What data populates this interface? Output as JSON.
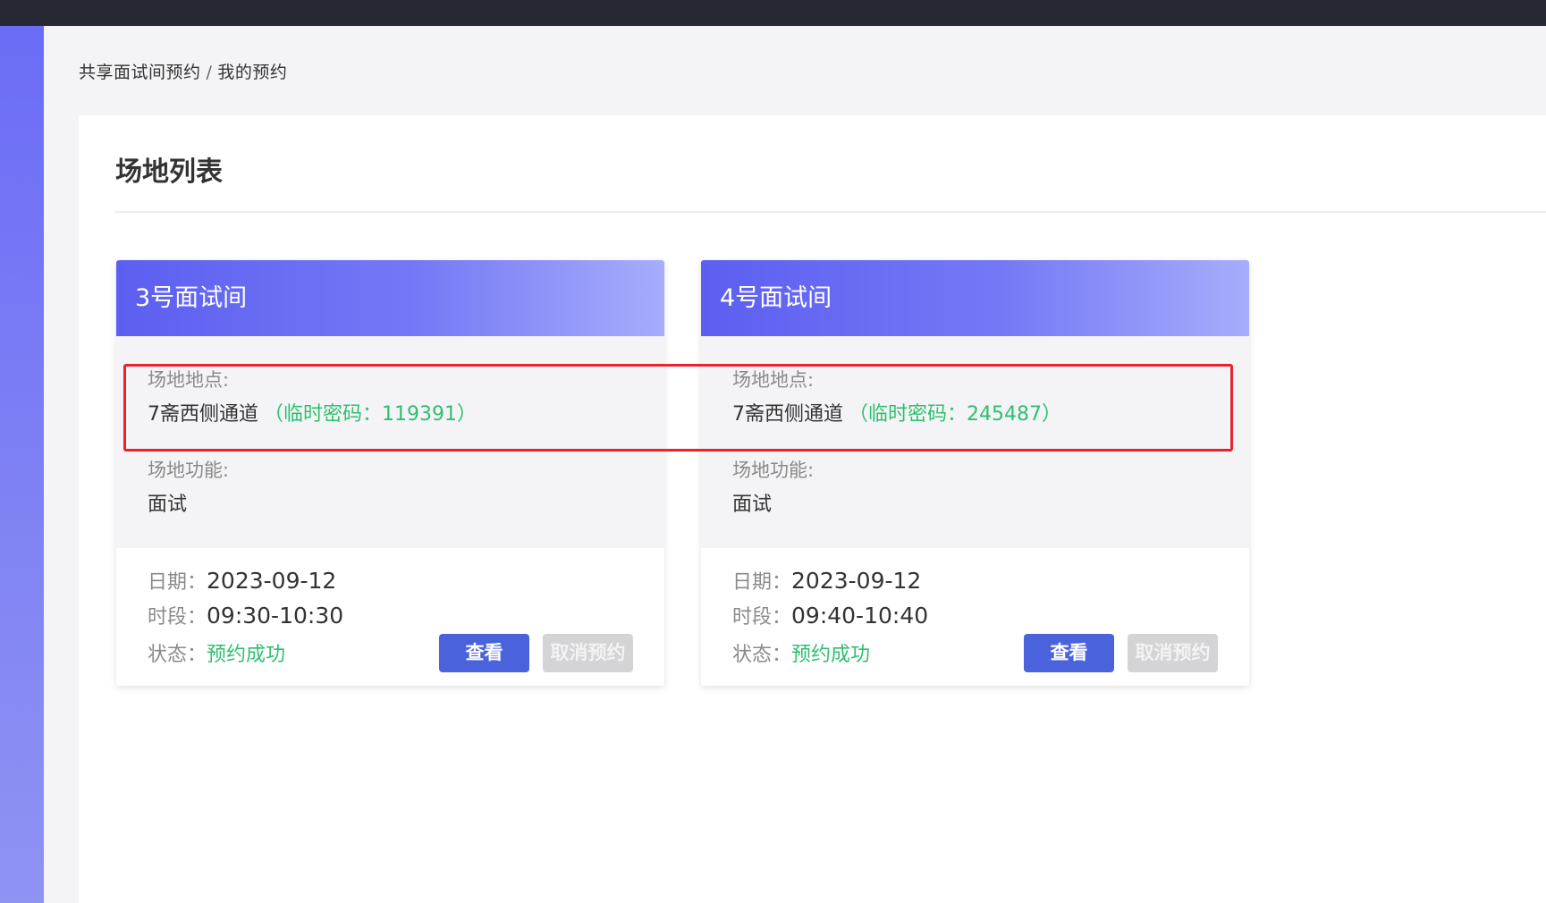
{
  "breadcrumb": {
    "root": "共享面试间预约",
    "separator": "/",
    "current": "我的预约"
  },
  "panel": {
    "title": "场地列表"
  },
  "cards": [
    {
      "name": "3号面试间",
      "location_label": "场地地点:",
      "location": "7斋西侧通道",
      "temp_password": "（临时密码：119391）",
      "function_label": "场地功能:",
      "function": "面试",
      "date_label": "日期：",
      "date": "2023-09-12",
      "time_label": "时段：",
      "time": "09:30-10:30",
      "status_label": "状态：",
      "status": "预约成功",
      "view_label": "查看",
      "cancel_label": "取消预约"
    },
    {
      "name": "4号面试间",
      "location_label": "场地地点:",
      "location": "7斋西侧通道",
      "temp_password": "（临时密码：245487）",
      "function_label": "场地功能:",
      "function": "面试",
      "date_label": "日期：",
      "date": "2023-09-12",
      "time_label": "时段：",
      "time": "09:40-10:40",
      "status_label": "状态：",
      "status": "预约成功",
      "view_label": "查看",
      "cancel_label": "取消预约"
    }
  ],
  "colors": {
    "accent": "#4a63dc",
    "success": "#2fbf71",
    "highlight": "#e8232e"
  }
}
